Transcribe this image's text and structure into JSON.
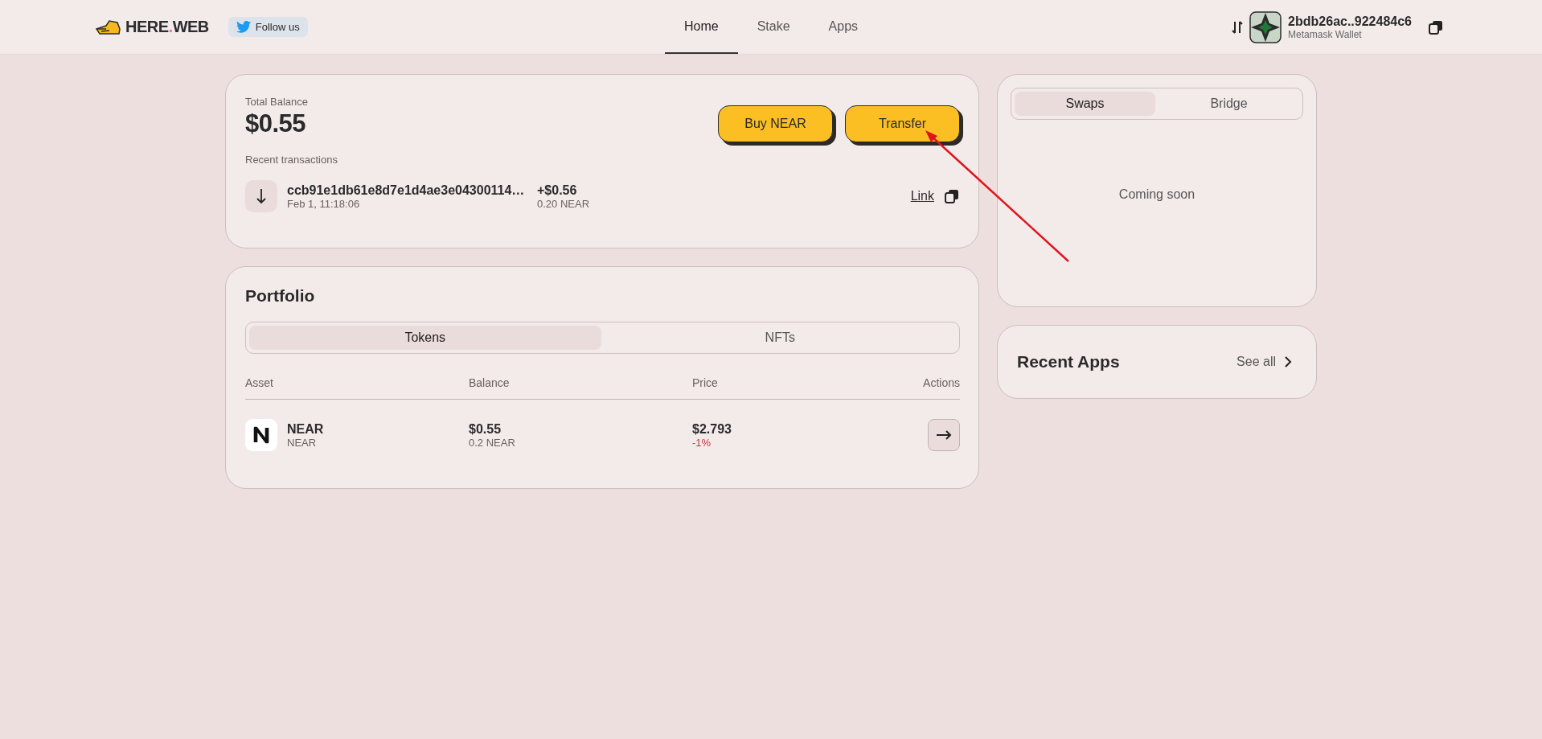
{
  "header": {
    "logo": {
      "name": "HERE",
      "dot": ".",
      "suffix": "WEB"
    },
    "follow_button": "Follow us",
    "nav": [
      {
        "label": "Home",
        "selected": true
      },
      {
        "label": "Stake",
        "selected": false
      },
      {
        "label": "Apps",
        "selected": false
      }
    ],
    "wallet": {
      "address": "2bdb26ac..922484c6",
      "name": "Metamask Wallet"
    }
  },
  "balance": {
    "label": "Total Balance",
    "amount": "$0.55",
    "buttons": [
      "Buy NEAR",
      "Transfer"
    ],
    "recent_label": "Recent transactions",
    "transactions": [
      {
        "kind": "in",
        "hash": "ccb91e1db61e8d7e1d4ae3e04300114…",
        "date": "Feb 1, 11:18:06",
        "amount": "+$0.56",
        "near": "0.20 NEAR",
        "link": "Link"
      }
    ]
  },
  "portfolio": {
    "title": "Portfolio",
    "tabs": [
      {
        "label": "Tokens",
        "selected": true
      },
      {
        "label": "NFTs",
        "selected": false
      }
    ],
    "columns": [
      "Asset",
      "Balance",
      "Price",
      "Actions"
    ],
    "rows": [
      {
        "name": "NEAR",
        "symbol": "NEAR",
        "balance": "$0.55",
        "amount": "0.2 NEAR",
        "price": "$2.793",
        "change": "-1%"
      }
    ]
  },
  "exchange": {
    "tabs": [
      {
        "label": "Swaps",
        "selected": true
      },
      {
        "label": "Bridge",
        "selected": false
      }
    ],
    "message": "Coming soon"
  },
  "recent_apps": {
    "title": "Recent Apps",
    "see_all": "See all"
  }
}
